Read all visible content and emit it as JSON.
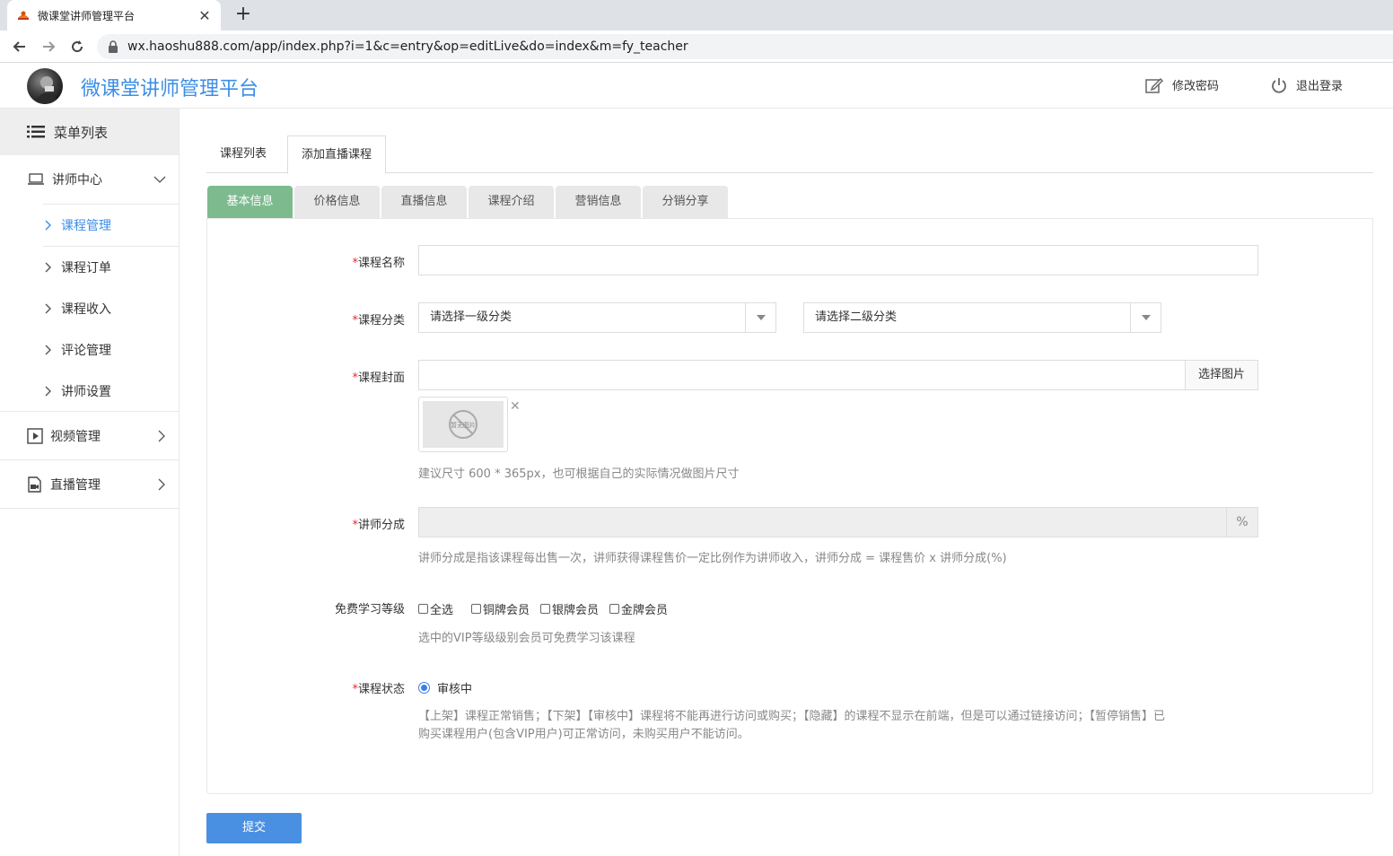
{
  "browser": {
    "tab_title": "微课堂讲师管理平台",
    "url": "wx.haoshu888.com/app/index.php?i=1&c=entry&op=editLive&do=index&m=fy_teacher"
  },
  "header": {
    "app_title": "微课堂讲师管理平台",
    "change_password": "修改密码",
    "logout": "退出登录",
    "accent_color": "#3d8ee6"
  },
  "sidebar": {
    "menu_title": "菜单列表",
    "group_teacher": "讲师中心",
    "items": [
      {
        "label": "课程管理"
      },
      {
        "label": "课程订单"
      },
      {
        "label": "课程收入"
      },
      {
        "label": "评论管理"
      },
      {
        "label": "讲师设置"
      }
    ],
    "group_video": "视频管理",
    "group_live": "直播管理"
  },
  "main": {
    "top_tabs": [
      "课程列表",
      "添加直播课程"
    ],
    "sub_tabs": [
      "基本信息",
      "价格信息",
      "直播信息",
      "课程介绍",
      "营销信息",
      "分销分享"
    ],
    "form": {
      "course_name_label": "课程名称",
      "course_category_label": "课程分类",
      "category1_placeholder": "请选择一级分类",
      "category2_placeholder": "请选择二级分类",
      "course_cover_label": "课程封面",
      "choose_image": "选择图片",
      "no_image_text": "暂无图片",
      "cover_help": "建议尺寸 600 * 365px，也可根据自己的实际情况做图片尺寸",
      "teacher_share_label": "讲师分成",
      "percent": "%",
      "share_help": "讲师分成是指该课程每出售一次，讲师获得课程售价一定比例作为讲师收入，讲师分成 = 课程售价 x 讲师分成(%)",
      "free_level_label": "免费学习等级",
      "levels": [
        "全选",
        "铜牌会员",
        "银牌会员",
        "金牌会员"
      ],
      "level_help": "选中的VIP等级级别会员可免费学习该课程",
      "status_label": "课程状态",
      "status_value": "审核中",
      "status_help_1": "【上架】课程正常销售；【下架】【审核中】课程将不能再进行访问或购买；【隐藏】的课程不显示在前端，但是可以通过链接访问；【暂停销售】已",
      "status_help_2": "购买课程用户(包含VIP用户)可正常访问，未购买用户不能访问。",
      "required_mark": "*"
    },
    "submit": "提交"
  }
}
